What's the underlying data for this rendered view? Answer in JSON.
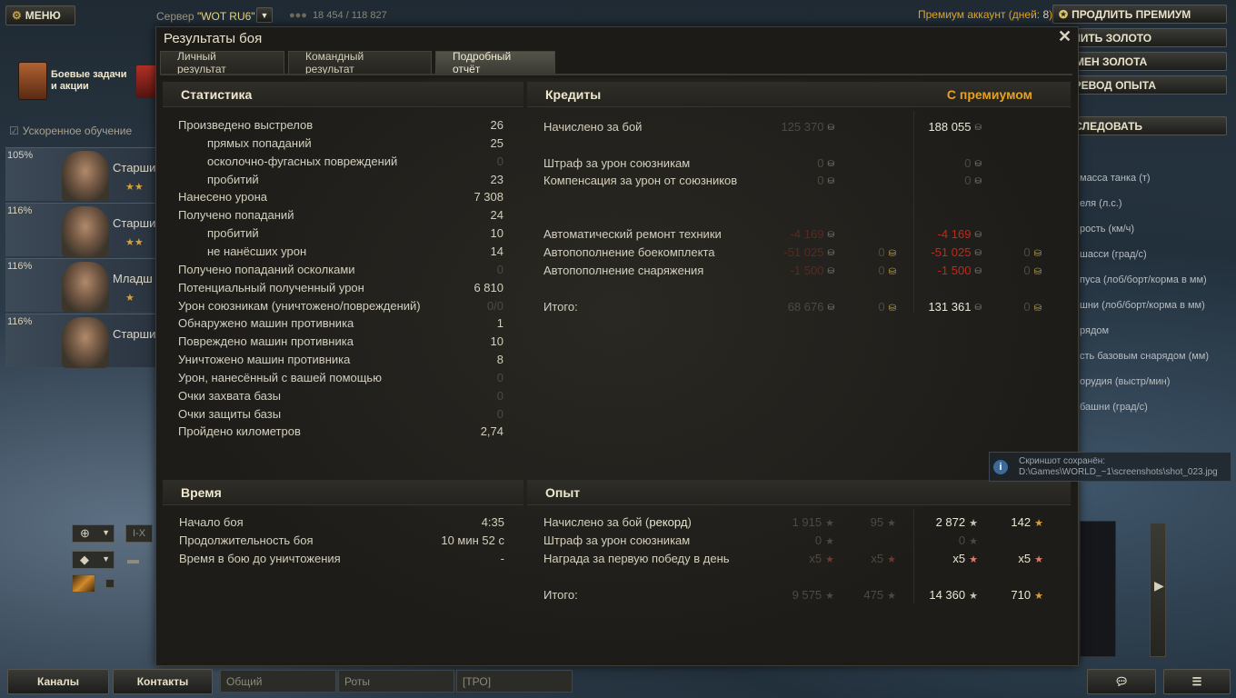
{
  "topbar": {
    "menu_label": "МЕНЮ",
    "server_label": "Сервер ",
    "server_name": "\"WOT RU6\"",
    "online": "18 454 / 118 827",
    "premium_label": "Премиум аккаунт (дней: ",
    "premium_days": "8",
    "premium_suffix": ")",
    "buttons": [
      "ПРОДЛИТЬ ПРЕМИУМ",
      "КУПИТЬ ЗОЛОТО",
      "ОБМЕН ЗОЛОТА",
      "ПЕРЕВОД ОПЫТА",
      "ИССЛЕДОВАТЬ"
    ]
  },
  "garage": {
    "quests": "Боевые задачи и акции",
    "accel": "Ускоренное обучение",
    "crew": [
      {
        "pct": "105%",
        "rank": "Старши"
      },
      {
        "pct": "116%",
        "rank": "Старши"
      },
      {
        "pct": "116%",
        "rank": "Младш"
      },
      {
        "pct": "116%",
        "rank": "Старши"
      }
    ],
    "right_stats": [
      "масса танка (т)",
      "еля (л.с.)",
      "рость (км/ч)",
      "шасси (град/с)",
      "пуса (лоб/борт/корма в мм)",
      "шни (лоб/борт/корма в мм)",
      "рядом",
      "сть базовым снарядом (мм)",
      "орудия (выстр/мин)",
      "башни (град/с)"
    ]
  },
  "modal": {
    "title": "Результаты боя",
    "tabs": [
      "Личный результат",
      "Командный результат",
      "Подробный отчёт"
    ],
    "stats": {
      "header": "Статистика",
      "rows": [
        {
          "label": "Произведено выстрелов",
          "value": "26",
          "indent": false,
          "dim": false
        },
        {
          "label": "прямых попаданий",
          "value": "25",
          "indent": true,
          "dim": false
        },
        {
          "label": "осколочно-фугасных повреждений",
          "value": "0",
          "indent": true,
          "dim": true
        },
        {
          "label": "пробитий",
          "value": "23",
          "indent": true,
          "dim": false
        },
        {
          "label": "Нанесено урона",
          "value": "7 308",
          "indent": false,
          "dim": false
        },
        {
          "label": "Получено попаданий",
          "value": "24",
          "indent": false,
          "dim": false
        },
        {
          "label": "пробитий",
          "value": "10",
          "indent": true,
          "dim": false
        },
        {
          "label": "не нанёсших урон",
          "value": "14",
          "indent": true,
          "dim": false
        },
        {
          "label": "Получено попаданий осколками",
          "value": "0",
          "indent": false,
          "dim": true
        },
        {
          "label": "Потенциальный полученный урон",
          "value": "6 810",
          "indent": false,
          "dim": false
        },
        {
          "label": "Урон союзникам (уничтожено/повреждений)",
          "value": "0/0",
          "indent": false,
          "dim": true
        },
        {
          "label": "Обнаружено машин противника",
          "value": "1",
          "indent": false,
          "dim": false
        },
        {
          "label": "Повреждено машин противника",
          "value": "10",
          "indent": false,
          "dim": false
        },
        {
          "label": "Уничтожено машин противника",
          "value": "8",
          "indent": false,
          "dim": false
        },
        {
          "label": "Урон, нанесённый с вашей помощью",
          "value": "0",
          "indent": false,
          "dim": true
        },
        {
          "label": "Очки захвата базы",
          "value": "0",
          "indent": false,
          "dim": true
        },
        {
          "label": "Очки защиты базы",
          "value": "0",
          "indent": false,
          "dim": true
        },
        {
          "label": "Пройдено километров",
          "value": "2,74",
          "indent": false,
          "dim": false
        }
      ]
    },
    "credits": {
      "header": "Кредиты",
      "premium_header": "С премиумом",
      "rows": [
        {
          "label": "Начислено за бой",
          "base": "125 370",
          "base_gold": "",
          "prem": "188 055",
          "prem_gold": "",
          "red": false
        },
        {
          "label": "Штраф за урон союзникам",
          "base": "0",
          "base_gold": "",
          "prem": "0",
          "prem_gold": "",
          "red": false
        },
        {
          "label": "Компенсация за урон от союзников",
          "base": "0",
          "base_gold": "",
          "prem": "0",
          "prem_gold": "",
          "red": false
        },
        {
          "label": "Автоматический ремонт техники",
          "base": "-4 169",
          "base_gold": "",
          "prem": "-4 169",
          "prem_gold": "",
          "red": true
        },
        {
          "label": "Автопополнение боекомплекта",
          "base": "-51 025",
          "base_gold": "0",
          "prem": "-51 025",
          "prem_gold": "0",
          "red": true
        },
        {
          "label": "Автопополнение снаряжения",
          "base": "-1 500",
          "base_gold": "0",
          "prem": "-1 500",
          "prem_gold": "0",
          "red": true
        },
        {
          "label": "Итого:",
          "base": "68 676",
          "base_gold": "0",
          "prem": "131 361",
          "prem_gold": "0",
          "red": false
        }
      ]
    },
    "time": {
      "header": "Время",
      "rows": [
        {
          "label": "Начало боя",
          "value": "4:35"
        },
        {
          "label": "Продолжительность боя",
          "value": "10 мин 52 с"
        },
        {
          "label": "Время в бою до уничтожения",
          "value": "-"
        }
      ]
    },
    "xp": {
      "header": "Опыт",
      "rows": [
        {
          "label": "Начислено за бой (",
          "label_bold": "рекорд",
          "label_end": ")",
          "b1": "1 915",
          "b2": "95",
          "p1": "2 872",
          "p2": "142"
        },
        {
          "label": "Штраф за урон союзникам",
          "label_bold": "",
          "label_end": "",
          "b1": "0",
          "b2": "",
          "p1": "0",
          "p2": ""
        },
        {
          "label": "Награда за первую победу в день",
          "label_bold": "",
          "label_end": "",
          "b1": "x5",
          "b2": "x5",
          "p1": "x5",
          "p2": "x5"
        },
        {
          "label": "Итого:",
          "label_bold": "",
          "label_end": "",
          "b1": "9 575",
          "b2": "475",
          "p1": "14 360",
          "p2": "710"
        }
      ]
    }
  },
  "notification": {
    "title": "Скриншот сохранён:",
    "path": "D:\\Games\\WORLD_~1\\screenshots\\shot_023.jpg"
  },
  "bottombar": {
    "channels": "Каналы",
    "contacts": "Контакты",
    "chat_tabs": [
      "Общий",
      "Роты",
      "[ТРО]"
    ]
  },
  "filters": {
    "tier_label": "I-X"
  }
}
